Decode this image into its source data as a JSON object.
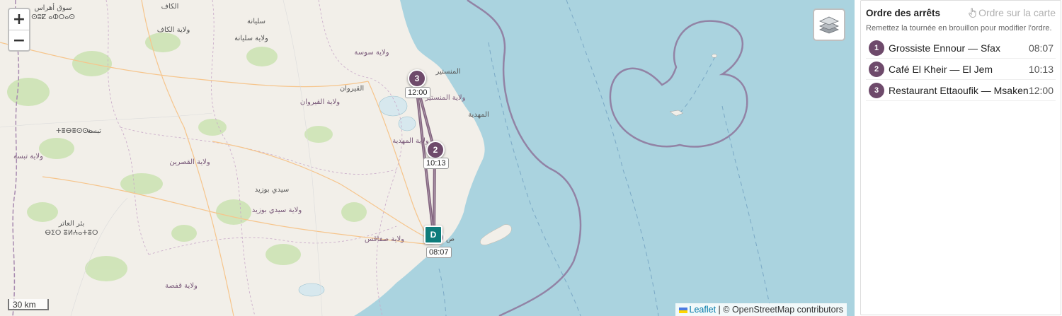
{
  "map": {
    "zoom_in_label": "+",
    "zoom_out_label": "−",
    "scale_label": "30 km",
    "attribution": {
      "leaflet": "Leaflet",
      "separator": "|",
      "osm": "© OpenStreetMap contributors"
    },
    "place_labels": {
      "kef_fr": "الكاف",
      "souk_ahras": "سوق أهراس",
      "souk_ahras_tfng": "ⵙⵓⵇ ⴰⵀⵔⴰⵙ",
      "wilaya_kef": "ولاية الكاف",
      "siliana": "سليانة",
      "wilaya_siliana": "ولاية سليانة",
      "wilaya_sousse": "ولاية سوسة",
      "monastir": "المنستير",
      "kairouan": "القيروان",
      "wilaya_kairouan": "ولاية القيروان",
      "wilaya_monastir": "ولاية المنستير",
      "mahdia": "المهدية",
      "wilaya_mahdia": "ولاية المهدية",
      "tebessa": "تبسة",
      "tebessa_tfng": "ⵜⴻⴱⴻⵙⵙⴰ",
      "wilaya_tebessa": "ولاية تبسة",
      "wilaya_kasserine": "ولاية القصرين",
      "sidi_bouzid": "سيدي بوزيد",
      "wilaya_sidi_bouzid": "ولاية سيدي بوزيد",
      "bir_el_ater": "بئر العاتر",
      "bir_el_ater_tfng": "ⴱⵉⵔ ⴻⵍⵄⴰⵜⴻⵔ",
      "wilaya_sfax": "ولاية صفاقس",
      "wilaya_gafsa": "ولاية قفصة",
      "sfax_short": "ص"
    },
    "markers": [
      {
        "label": "3",
        "time": "12:00"
      },
      {
        "label": "2",
        "time": "10:13"
      },
      {
        "label": "D",
        "time": "08:07"
      }
    ]
  },
  "panel": {
    "title": "Ordre des arrêts",
    "map_order_label": "Ordre sur la carte",
    "subtitle": "Remettez la tournée en brouillon pour modifier l'ordre.",
    "stops": [
      {
        "index": "1",
        "name": "Grossiste Ennour — Sfax",
        "time": "08:07"
      },
      {
        "index": "2",
        "name": "Café El Kheir — El Jem",
        "time": "10:13"
      },
      {
        "index": "3",
        "name": "Restaurant Ettaoufik — Msaken",
        "time": "12:00"
      }
    ]
  },
  "colors": {
    "route": "#6e4a6b",
    "depot": "#0e7c7b",
    "sea": "#aad3df",
    "land": "#f2efe9"
  }
}
